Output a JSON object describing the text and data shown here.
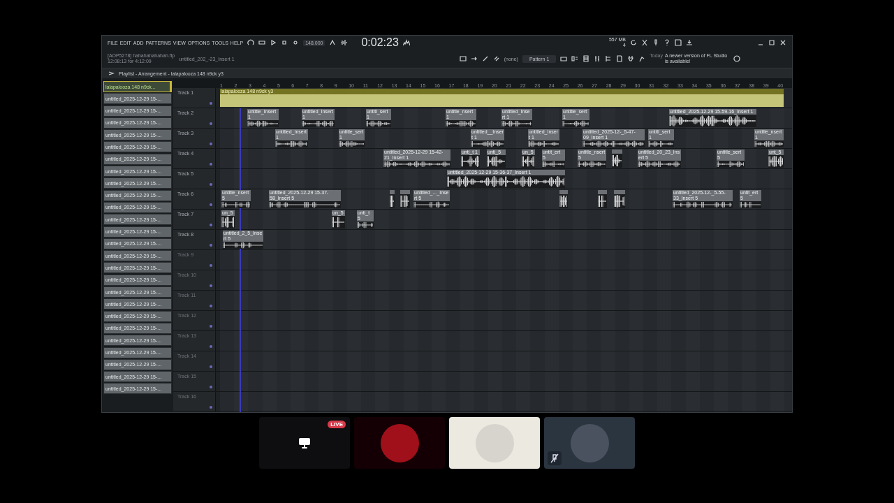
{
  "menu": [
    "FILE",
    "EDIT",
    "ADD",
    "PATTERNS",
    "VIEW",
    "OPTIONS",
    "TOOLS",
    "HELP"
  ],
  "project": {
    "file": "[AOP5278] hahahahahahah.flp",
    "time": "12:08:13 for 4:12:09",
    "hint": "untitled_202_-23_Insert 1"
  },
  "transport": {
    "tempo": "148.000",
    "song_time": "0:02:23",
    "memory": "557 MB",
    "cpu": "4",
    "pattern": "Pattern 1",
    "snap": "(none)"
  },
  "news": {
    "date": "Today",
    "text": "A newer version of FL Studio is available!"
  },
  "playlist": {
    "title": "Playlist - Arrangement - lalapalooza 148 n9ck y3",
    "ruler": [
      "1",
      "2",
      "3",
      "4",
      "5",
      "6",
      "7",
      "8",
      "9",
      "10",
      "11",
      "12",
      "13",
      "14",
      "15",
      "16",
      "17",
      "18",
      "19",
      "20",
      "21",
      "22",
      "23",
      "24",
      "25",
      "26",
      "27",
      "28",
      "29",
      "30",
      "31",
      "32",
      "33",
      "34",
      "35",
      "36",
      "37",
      "38",
      "39",
      "40"
    ],
    "patterns": [
      {
        "label": "lalapalooza 148 n9ck...",
        "selected": true
      },
      {
        "label": "untitled_2025-12-29 15-...",
        "selected": false
      },
      {
        "label": "untitled_2025-12-29 15-...",
        "selected": false
      },
      {
        "label": "untitled_2025-12-29 15-...",
        "selected": false
      },
      {
        "label": "untitled_2025-12-29 15-...",
        "selected": false
      },
      {
        "label": "untitled_2025-12-29 15-...",
        "selected": false
      },
      {
        "label": "untitled_2025-12-29 15-...",
        "selected": false
      },
      {
        "label": "untitled_2025-12-29 15-...",
        "selected": false
      },
      {
        "label": "untitled_2025-12-29 15-...",
        "selected": false
      },
      {
        "label": "untitled_2025-12-29 15-...",
        "selected": false
      },
      {
        "label": "untitled_2025-12-29 15-...",
        "selected": false
      },
      {
        "label": "untitled_2025-12-29 15-...",
        "selected": false
      },
      {
        "label": "untitled_2025-12-29 15-...",
        "selected": false
      },
      {
        "label": "untitled_2025-12-29 15-...",
        "selected": false
      },
      {
        "label": "untitled_2025-12-29 15-...",
        "selected": false
      },
      {
        "label": "untitled_2025-12-29 15-...",
        "selected": false
      },
      {
        "label": "untitled_2025-12-29 15-...",
        "selected": false
      },
      {
        "label": "untitled_2025-12-29 15-...",
        "selected": false
      },
      {
        "label": "untitled_2025-12-29 15-...",
        "selected": false
      },
      {
        "label": "untitled_2025-12-29 15-...",
        "selected": false
      },
      {
        "label": "untitled_2025-12-29 15-...",
        "selected": false
      },
      {
        "label": "untitled_2025-12-29 15-...",
        "selected": false
      },
      {
        "label": "untitled_2025-12-29 15-...",
        "selected": false
      },
      {
        "label": "untitled_2025-12-29 15-...",
        "selected": false
      },
      {
        "label": "untitled_2025-12-29 15-...",
        "selected": false
      },
      {
        "label": "untitled_2025-12-29 15-...",
        "selected": false
      }
    ],
    "tracks": [
      {
        "name": "Track 1",
        "clips": [
          {
            "kind": "pattern",
            "label": "lalapalooza 148 n9ck y3"
          }
        ]
      },
      {
        "name": "Track 2",
        "clips": [
          {
            "kind": "audio",
            "label": "untitle_Insert 1"
          },
          {
            "kind": "audio",
            "label": "untitled_Insert 1"
          },
          {
            "kind": "audio",
            "label": "untitl_sert 1"
          },
          {
            "kind": "audio",
            "label": "untitle_nsert 1"
          },
          {
            "kind": "audio",
            "label": "untitled_Insert 1"
          },
          {
            "kind": "audio",
            "label": "untitle_sert 1"
          },
          {
            "kind": "audio",
            "label": "untitled_2025-12-29 15-59-16_Insert 1"
          }
        ]
      },
      {
        "name": "Track 3",
        "clips": [
          {
            "kind": "audio",
            "label": "untitled_Insert 1"
          },
          {
            "kind": "audio",
            "label": "untitle_sert 1"
          },
          {
            "kind": "audio",
            "label": "untitled__Insert 1"
          },
          {
            "kind": "audio",
            "label": "untitled_Insert 1"
          },
          {
            "kind": "audio",
            "label": "untitled_2025-12-_5-47-09_Insert 1"
          },
          {
            "kind": "audio",
            "label": "untitl_sert 1"
          },
          {
            "kind": "audio",
            "label": "untitle_nsert 1"
          }
        ]
      },
      {
        "name": "Track 4",
        "clips": [
          {
            "kind": "audio",
            "label": "untitled_2025-12-29 15-42-21_Insert 1"
          },
          {
            "kind": "audio",
            "label": "unti_t 1"
          },
          {
            "kind": "audio",
            "label": "unti_5"
          },
          {
            "kind": "audio",
            "label": "un_5"
          },
          {
            "kind": "audio",
            "label": "untit_ert 5"
          },
          {
            "kind": "audio",
            "label": "untitle_nsert 5"
          },
          {
            "kind": "audio"
          },
          {
            "kind": "audio",
            "label": "untitled_20_23_Insert 5"
          },
          {
            "kind": "audio",
            "label": "untitle_sert 5"
          },
          {
            "kind": "audio",
            "label": "unt_5"
          }
        ]
      },
      {
        "name": "Track 5",
        "clips": [
          {
            "kind": "audio",
            "label": "untitled_2025-12-29 15-36-37_Insert 1"
          }
        ]
      },
      {
        "name": "Track 6",
        "clips": [
          {
            "kind": "audio",
            "label": "untitle_nsert 5"
          },
          {
            "kind": "audio",
            "label": "untitled_2025-12-29 15-37-58_Insert 5"
          },
          {
            "kind": "audio"
          },
          {
            "kind": "audio"
          },
          {
            "kind": "audio",
            "label": "untitled_..._Insert 5"
          },
          {
            "kind": "audio"
          },
          {
            "kind": "audio"
          },
          {
            "kind": "audio"
          },
          {
            "kind": "audio",
            "label": "untitled_2025-12-_5-55-33_Insert 5"
          },
          {
            "kind": "audio",
            "label": "untit_ert 5"
          }
        ]
      },
      {
        "name": "Track 7",
        "clips": [
          {
            "kind": "audio",
            "label": "un_5"
          },
          {
            "kind": "audio",
            "label": "un_5"
          },
          {
            "kind": "audio",
            "label": "unti_t 5"
          }
        ]
      },
      {
        "name": "Track 8",
        "clips": [
          {
            "kind": "audio",
            "label": "untitled_2_5_Insert 5"
          }
        ]
      },
      {
        "name": "Track 9"
      },
      {
        "name": "Track 10"
      },
      {
        "name": "Track 11"
      },
      {
        "name": "Track 12"
      },
      {
        "name": "Track 13"
      },
      {
        "name": "Track 14"
      },
      {
        "name": "Track 15"
      },
      {
        "name": "Track 16"
      }
    ]
  },
  "call": {
    "tiles": [
      {
        "kind": "screen",
        "badge": "LIVE",
        "muted": false
      },
      {
        "kind": "avatar",
        "muted": false
      },
      {
        "kind": "avatar",
        "muted": false
      },
      {
        "kind": "avatar",
        "muted": true
      }
    ]
  }
}
